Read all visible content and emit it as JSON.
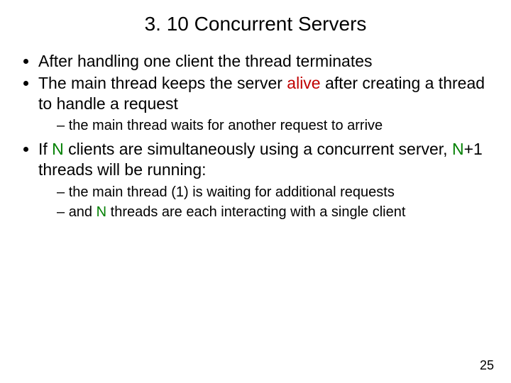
{
  "title": "3. 10  Concurrent Servers",
  "b1": "After handling one client the thread terminates",
  "b2a": "The main thread keeps the server ",
  "b2_alive": "alive",
  "b2b": " after creating a thread to handle a request",
  "b2s1": "the main thread waits for another request to arrive",
  "b3a": "If ",
  "b3_N1": "N",
  "b3b": " clients are simultaneously using a concurrent server, ",
  "b3_N2": "N",
  "b3c": "+1 threads will be running:",
  "b3s1": "the main thread (1) is waiting for additional requests",
  "b3s2a": "and ",
  "b3s2_N": "N",
  "b3s2b": " threads are each interacting with a single client",
  "pagenum": "25"
}
